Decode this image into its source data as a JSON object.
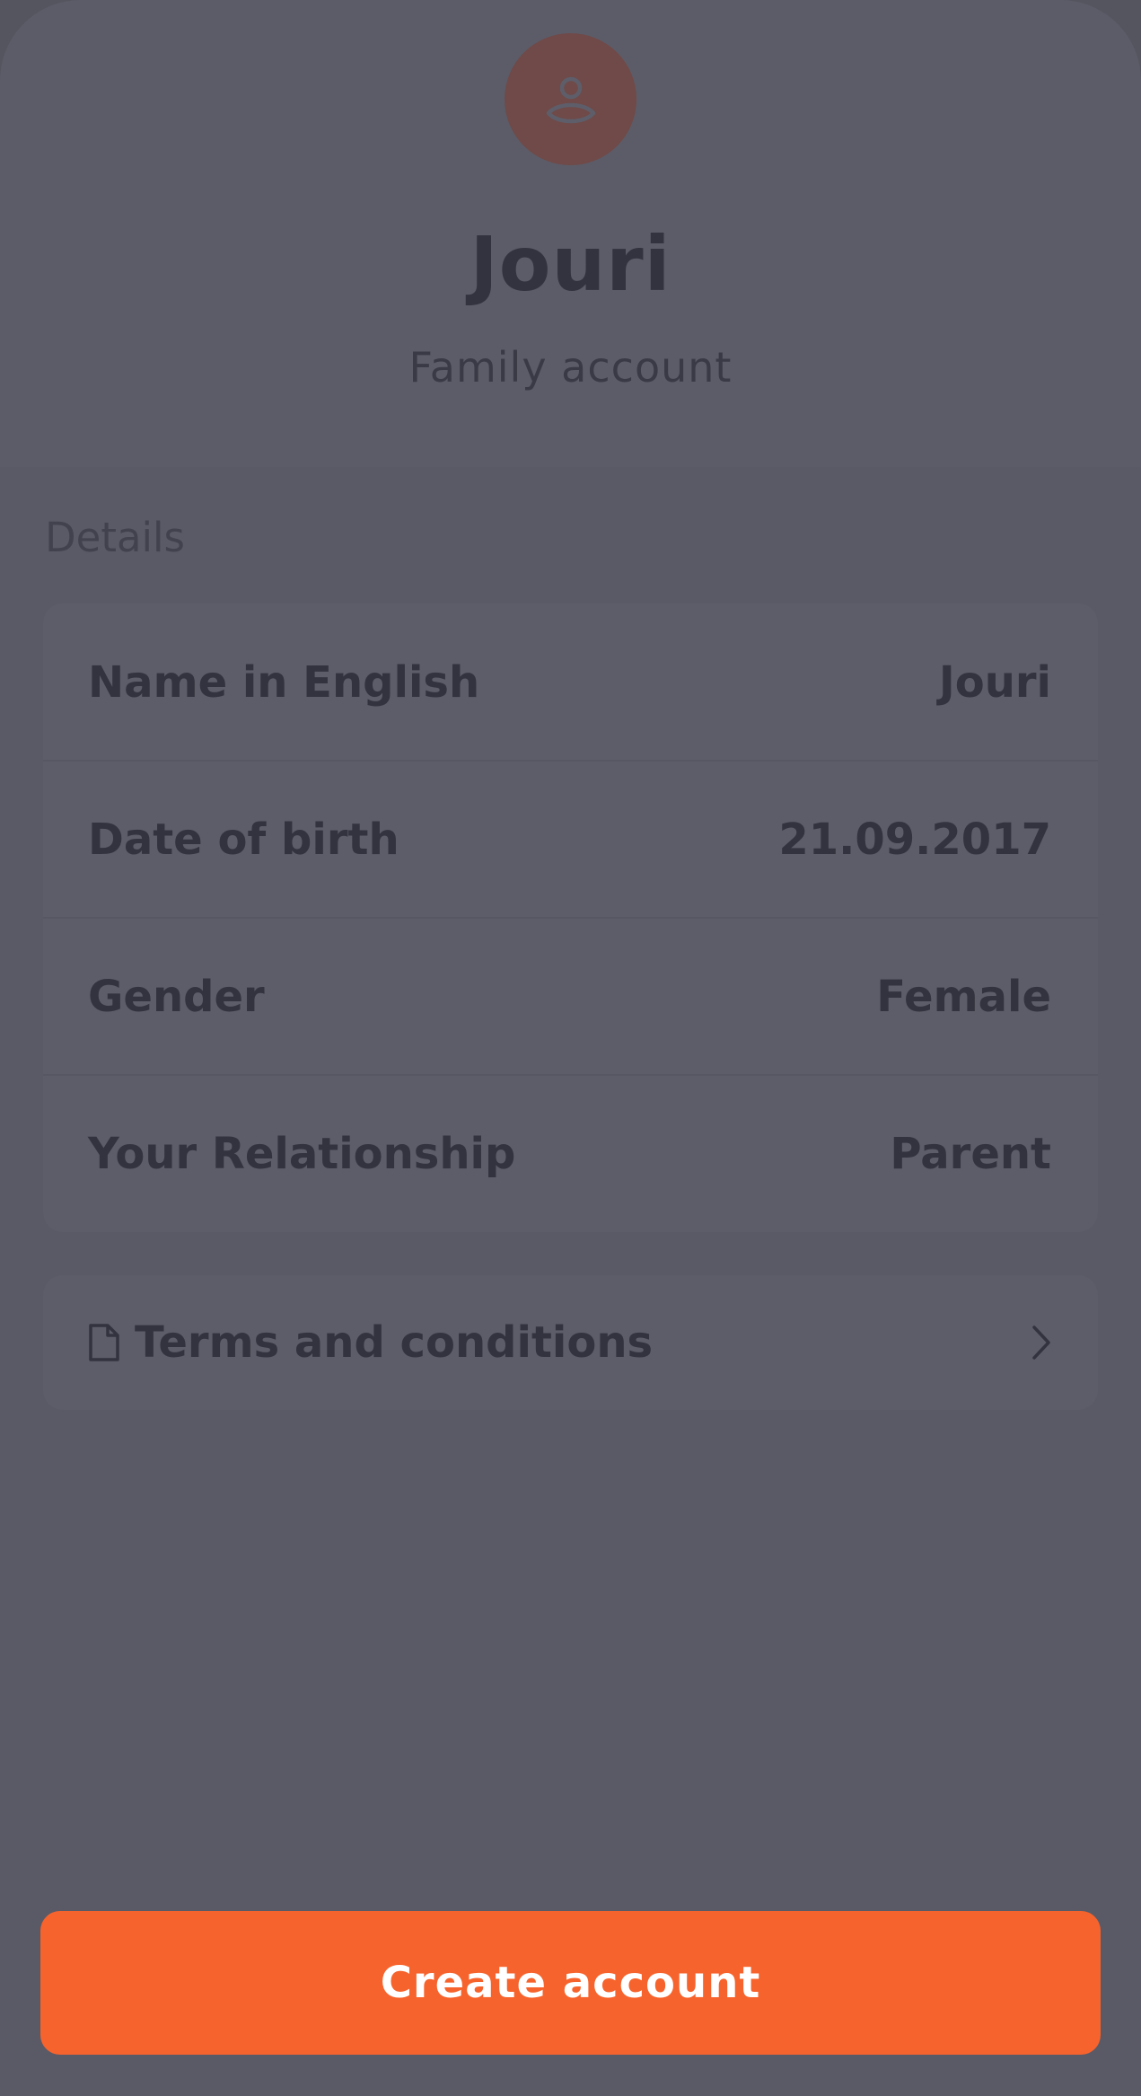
{
  "profile": {
    "name": "Jouri",
    "account_type": "Family account",
    "avatar_icon": "user-icon"
  },
  "details": {
    "section_label": "Details",
    "rows": [
      {
        "label": "Name in English",
        "value": "Jouri"
      },
      {
        "label": "Date of birth",
        "value": "21.09.2017"
      },
      {
        "label": "Gender",
        "value": "Female"
      },
      {
        "label": "Your Relationship",
        "value": "Parent"
      }
    ]
  },
  "terms": {
    "label": "Terms and conditions",
    "icon": "document-icon"
  },
  "actions": {
    "create_label": "Create account"
  },
  "colors": {
    "accent": "#f7632c",
    "background": "#55555f",
    "card": "#5d5d69",
    "text": "#33333f"
  }
}
